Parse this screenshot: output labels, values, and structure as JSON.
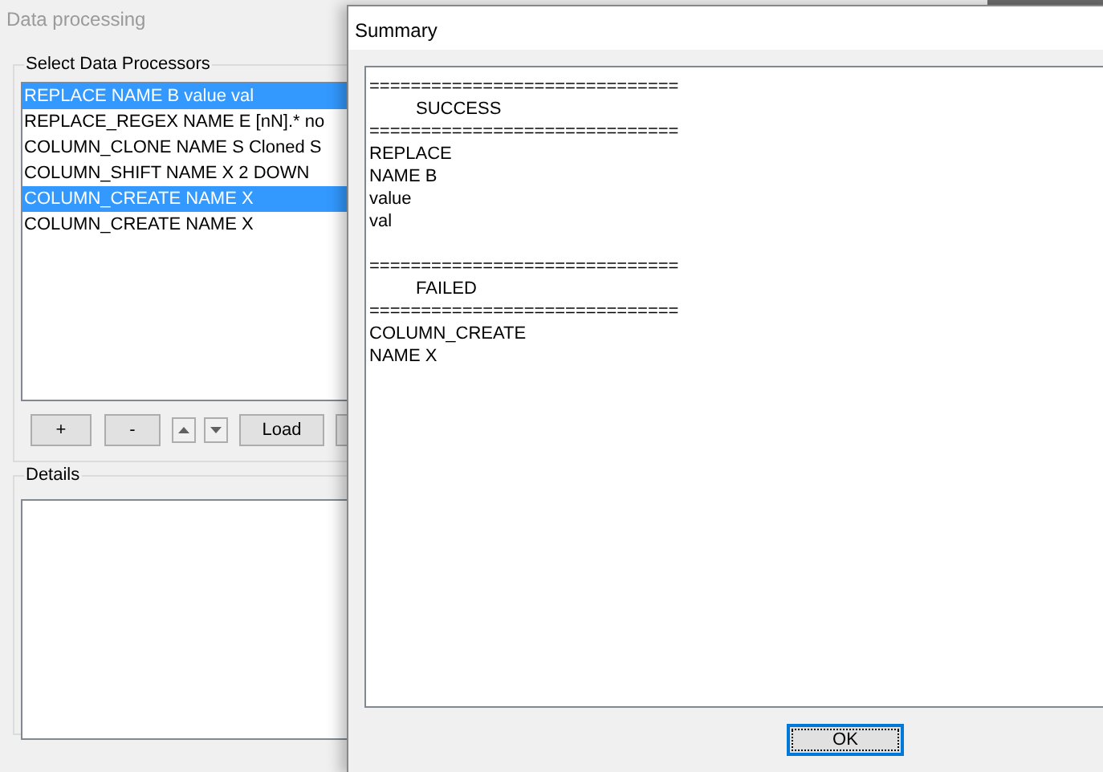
{
  "main_window": {
    "title": "Data processing",
    "processors_group": {
      "label": "Select Data Processors",
      "items": [
        {
          "label": "REPLACE NAME B value val",
          "selected": true
        },
        {
          "label": "REPLACE_REGEX NAME E [nN].* no",
          "selected": false
        },
        {
          "label": "COLUMN_CLONE NAME S Cloned S",
          "selected": false
        },
        {
          "label": "COLUMN_SHIFT NAME X 2 DOWN",
          "selected": false
        },
        {
          "label": "COLUMN_CREATE NAME X",
          "selected": true
        },
        {
          "label": "COLUMN_CREATE NAME X",
          "selected": false
        }
      ],
      "buttons": [
        {
          "kind": "text",
          "label": "+"
        },
        {
          "kind": "text",
          "label": "-"
        },
        {
          "kind": "up"
        },
        {
          "kind": "down"
        },
        {
          "kind": "text",
          "label": "Load"
        },
        {
          "kind": "cut"
        }
      ]
    },
    "details_group": {
      "label": "Details"
    }
  },
  "summary_dialog": {
    "title": "Summary",
    "sections": [
      {
        "rule": "==============================",
        "heading": "SUCCESS",
        "lines": [
          "REPLACE",
          "NAME B",
          "value",
          "val"
        ]
      },
      {
        "rule": "==============================",
        "heading": "FAILED",
        "lines": [
          "COLUMN_CREATE",
          "NAME X"
        ]
      }
    ],
    "ok_button": "OK"
  }
}
